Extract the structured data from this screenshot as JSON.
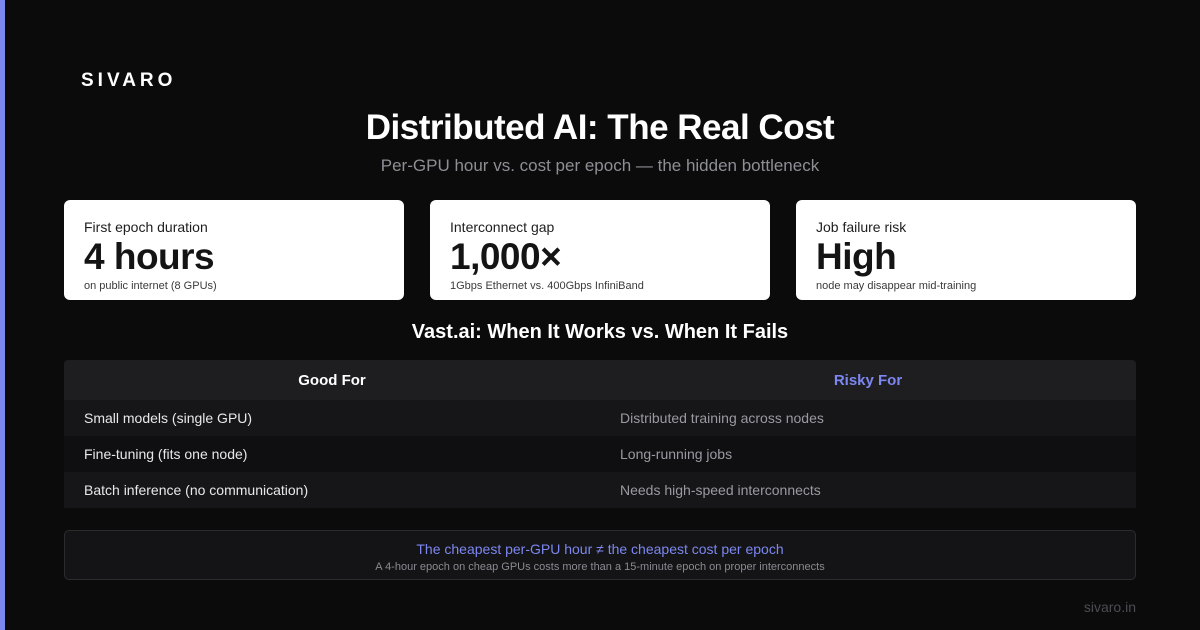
{
  "brand": {
    "logo": "SIVARO",
    "accent_color": "#7c87f0",
    "footer_url": "sivaro.in"
  },
  "header": {
    "title": "Distributed AI: The Real Cost",
    "subtitle": "Per-GPU hour vs. cost per epoch — the hidden bottleneck"
  },
  "stats": [
    {
      "label": "First epoch duration",
      "value": "4 hours",
      "note": "on public internet (8 GPUs)"
    },
    {
      "label": "Interconnect gap",
      "value": "1,000×",
      "note": "1Gbps Ethernet vs. 400Gbps InfiniBand"
    },
    {
      "label": "Job failure risk",
      "value": "High",
      "note": "node may disappear mid-training"
    }
  ],
  "comparison": {
    "title": "Vast.ai: When It Works vs. When It Fails",
    "headers": {
      "good": "Good For",
      "risky": "Risky For"
    },
    "rows": [
      {
        "good": "Small models (single GPU)",
        "risky": "Distributed training across nodes"
      },
      {
        "good": "Fine-tuning (fits one node)",
        "risky": "Long-running jobs"
      },
      {
        "good": "Batch inference (no communication)",
        "risky": "Needs high-speed interconnects"
      }
    ]
  },
  "callout": {
    "main": "The cheapest per-GPU hour ≠ the cheapest cost per epoch",
    "sub": "A 4-hour epoch on cheap GPUs costs more than a 15-minute epoch on proper interconnects"
  }
}
